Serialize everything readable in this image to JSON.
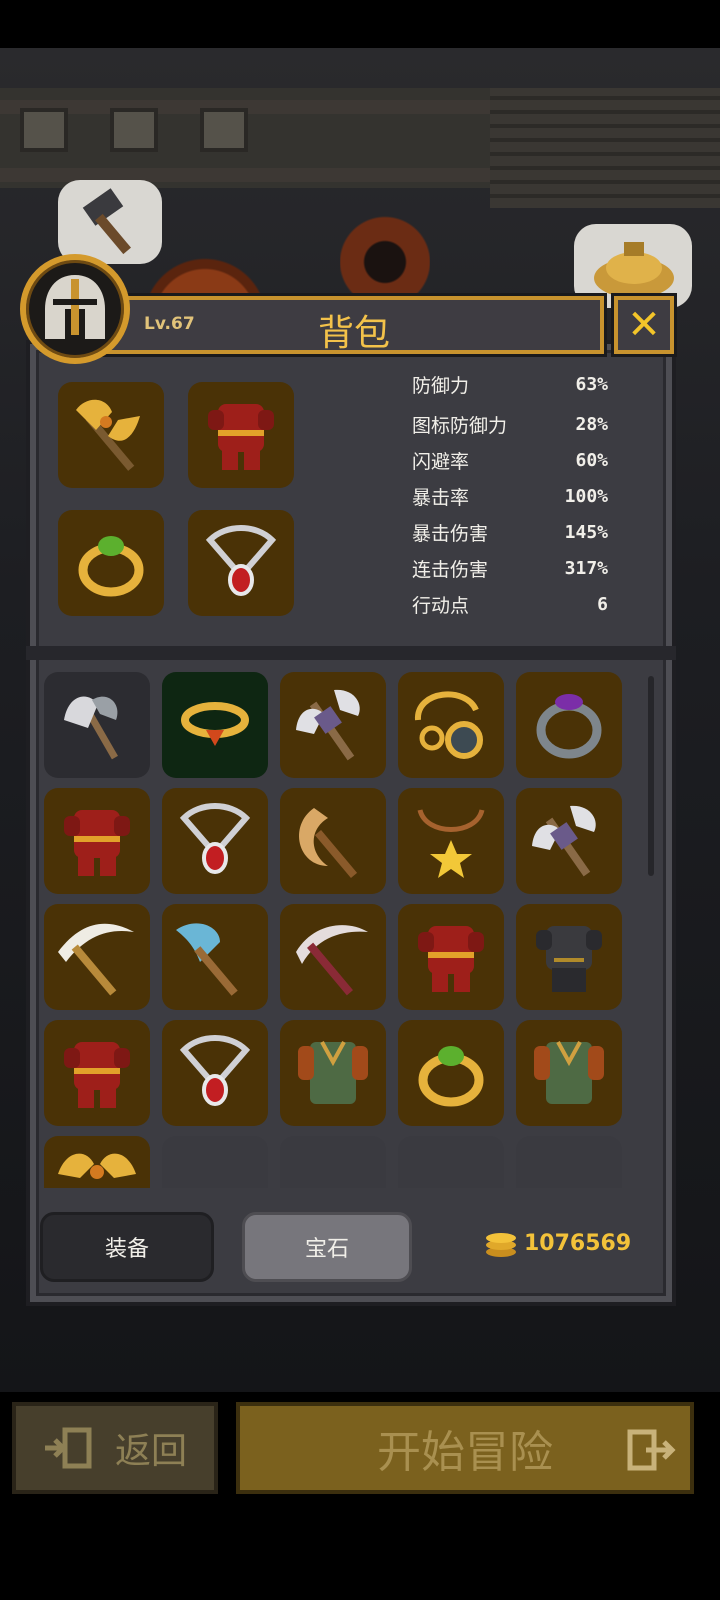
{
  "header": {
    "level": "Lv.67",
    "title": "背包"
  },
  "close_icon": "close-x-icon",
  "equipped": [
    {
      "icon": "golden-double-axe-icon"
    },
    {
      "icon": "red-armor-icon"
    },
    {
      "icon": "gold-emerald-ring-icon"
    },
    {
      "icon": "silver-ruby-amulet-icon"
    }
  ],
  "stats": [
    {
      "label": "防御力",
      "value": "63%"
    },
    {
      "label": "图标防御力",
      "value": "28%"
    },
    {
      "label": "闪避率",
      "value": "60%"
    },
    {
      "label": "暴击率",
      "value": "100%"
    },
    {
      "label": "暴击伤害",
      "value": "145%"
    },
    {
      "label": "连击伤害",
      "value": "317%"
    },
    {
      "label": "行动点",
      "value": "6"
    }
  ],
  "inventory": [
    {
      "icon": "iron-battle-axe-icon"
    },
    {
      "icon": "gold-ruby-ring-icon"
    },
    {
      "icon": "purple-double-axe-icon"
    },
    {
      "icon": "gold-chain-amulet-icon"
    },
    {
      "icon": "amethyst-ring-icon"
    },
    {
      "icon": "red-armor-icon"
    },
    {
      "icon": "silver-ruby-amulet-icon"
    },
    {
      "icon": "moon-axe-icon"
    },
    {
      "icon": "star-necklace-icon"
    },
    {
      "icon": "purple-double-axe-icon"
    },
    {
      "icon": "golden-pickaxe-icon"
    },
    {
      "icon": "blue-axe-icon"
    },
    {
      "icon": "crimson-pickaxe-icon"
    },
    {
      "icon": "red-armor-icon"
    },
    {
      "icon": "black-armor-icon"
    },
    {
      "icon": "red-armor-icon"
    },
    {
      "icon": "silver-ruby-amulet-icon"
    },
    {
      "icon": "green-tunic-icon"
    },
    {
      "icon": "gold-emerald-ring-icon"
    },
    {
      "icon": "green-tunic-icon"
    },
    {
      "icon": "golden-double-axe-icon"
    },
    {
      "icon": "empty-slot"
    },
    {
      "icon": "empty-slot"
    },
    {
      "icon": "empty-slot"
    },
    {
      "icon": "empty-slot"
    }
  ],
  "tabs": {
    "equip_label": "装备",
    "gem_label": "宝石"
  },
  "gold": {
    "amount": "1076569",
    "icon": "gold-coins-icon"
  },
  "buttons": {
    "back_label": "返回",
    "start_label": "开始冒险"
  },
  "colors": {
    "accent_gold": "#f3c24a",
    "panel_border": "#c8932e",
    "slot_brown": "#4a3206",
    "start_button": "#7b611e"
  }
}
